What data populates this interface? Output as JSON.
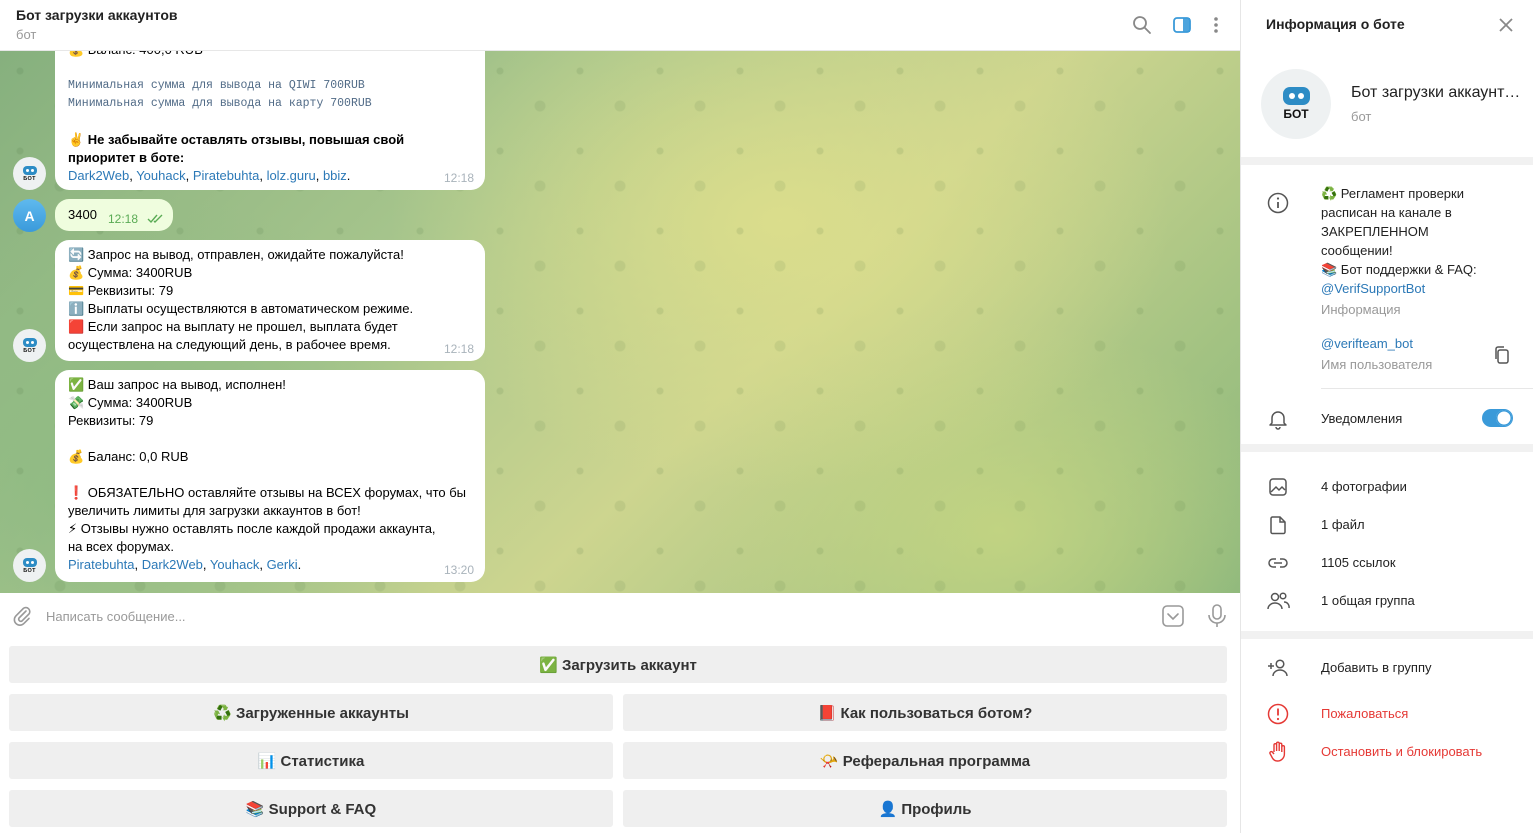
{
  "header": {
    "title": "Бот загрузки аккаунтов",
    "status": "бот",
    "icons": [
      "search-icon",
      "sidebar-toggle-icon",
      "more-vertical-icon"
    ]
  },
  "messages": [
    {
      "lines": [
        "💰 Баланс: 400,0 RUB",
        "",
        "Минимальная сумма для вывода на QIWI 700RUB",
        "Минимальная сумма для вывода на карту 700RUB",
        "",
        "✌️ Не забывайте оставлять отзывы, повышая свой",
        "приоритет в боте:"
      ],
      "links": [
        "Dark2Web",
        "Youhack",
        "Piratebuhta",
        "lolz.guru",
        "bbiz"
      ],
      "time": "12:18"
    },
    {
      "lines": [
        "🔄 Запрос на вывод, отправлен, ожидайте пожалуйста!",
        "💰 Сумма: 3400RUB",
        "💳 Реквизиты: 79",
        "ℹ️ Выплаты осуществляются в автоматическом режиме.",
        "🟥 Если запрос на выплату не прошел, выплата будет",
        "осуществлена на следующий день, в рабочее время."
      ],
      "time": "12:18"
    },
    {
      "lines": [
        "✅ Ваш запрос на вывод, исполнен!",
        "💸 Сумма: 3400RUB",
        "Реквизиты: 79",
        "",
        "💰 Баланс: 0,0 RUB",
        "",
        "❗ ОБЯЗАТЕЛЬНО оставляйте отзывы на ВСЕХ форумах, что бы",
        "увеличить лимиты для загрузки аккаунтов в бот!",
        "⚡ Отзывы нужно оставлять после каждой продажи аккаунта,",
        "на всех форумах."
      ],
      "links": [
        "Piratebuhta",
        "Dark2Web",
        "Youhack",
        "Gerki"
      ],
      "time": "13:20"
    }
  ],
  "outgoing": {
    "avatar_letter": "A",
    "text": "3400",
    "time": "12:18"
  },
  "composer": {
    "placeholder": "Написать сообщение..."
  },
  "keyboard": {
    "upload": "✅ Загрузить аккаунт",
    "uploaded": "♻️ Загруженные аккаунты",
    "howto": "📕 Как пользоваться ботом?",
    "stats": "📊 Статистика",
    "referral": "📯 Реферальная программа",
    "support": "📚 Support & FAQ",
    "profile": "👤 Профиль"
  },
  "panel": {
    "title": "Информация о боте",
    "name": "Бот загрузки аккаунтов",
    "subtitle": "бот",
    "avatar_text": "БОТ",
    "info_lines": [
      "♻️ Регламент проверки",
      "расписан на канале в",
      "ЗАКРЕПЛЕННОМ",
      "сообщении!",
      "📚 Бот поддержки & FAQ:"
    ],
    "info_link": "@VerifSupportBot",
    "info_label": "Информация",
    "username": "@verifteam_bot",
    "username_label": "Имя пользователя",
    "notifications": "Уведомления",
    "notifications_on": true,
    "media": {
      "photos": "4 фотографии",
      "files": "1 файл",
      "links": "1105 ссылок",
      "groups": "1 общая группа"
    },
    "actions": {
      "add_to_group": "Добавить в группу",
      "report": "Пожаловаться",
      "block": "Остановить и блокировать"
    },
    "colors": {
      "accent": "#3a9ad9",
      "danger": "#e53935"
    }
  }
}
